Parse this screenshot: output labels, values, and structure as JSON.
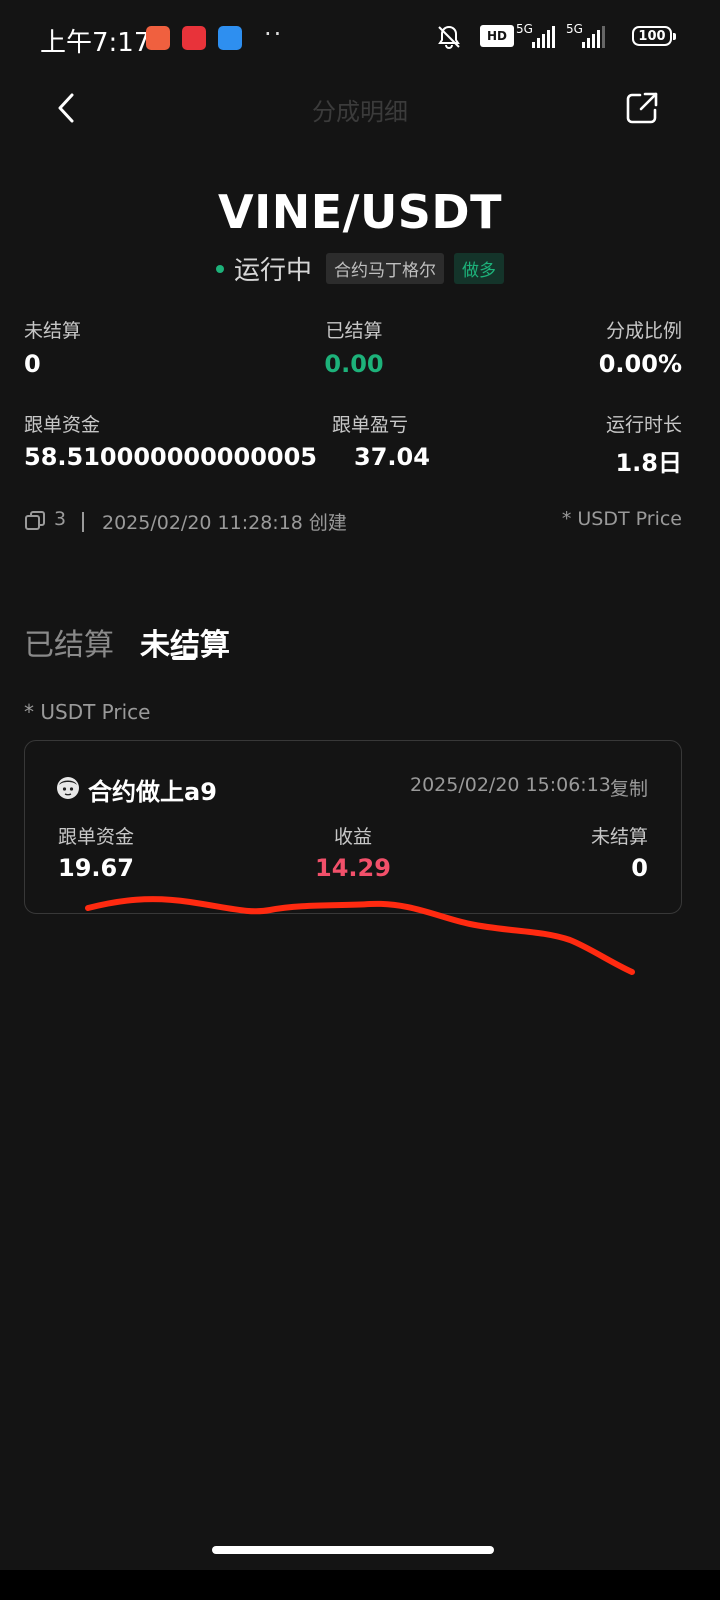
{
  "status_bar": {
    "time": "上午7:17",
    "network_1": "5G",
    "network_2": "5G",
    "hd": "HD",
    "battery": "100",
    "icons": [
      "app-red-icon",
      "app-badge-icon",
      "app-blue-icon",
      "bell-muted-icon"
    ]
  },
  "nav": {
    "title": "分成明细",
    "back_icon": "arrow-left-icon",
    "share_icon": "share-icon"
  },
  "header": {
    "pair": "VINE/USDT",
    "status": "运行中",
    "strategy_tag": "合约马丁格尔",
    "direction_tag": "做多"
  },
  "stats": {
    "unsettled_label": "未结算",
    "unsettled_value": "0",
    "settled_label": "已结算",
    "settled_value": "0.00",
    "share_ratio_label": "分成比例",
    "share_ratio_value": "0.00%",
    "copy_funds_label": "跟单资金",
    "copy_funds_value": "58.510000000000005",
    "copy_pnl_label": "跟单盈亏",
    "copy_pnl_value": "37.04",
    "runtime_label": "运行时长",
    "runtime_value": "1.8日"
  },
  "meta": {
    "copy_count": "3",
    "created": "2025/02/20 11:28:18 创建",
    "price_note": "* USDT Price"
  },
  "tabs": [
    {
      "label": "已结算",
      "active": false
    },
    {
      "label": "未结算",
      "active": true
    }
  ],
  "list_note": "* USDT Price",
  "records": [
    {
      "user": "合约做上a9",
      "timestamp": "2025/02/20 15:06:13",
      "copy_action": "复制",
      "funds_label": "跟单资金",
      "funds_value": "19.67",
      "profit_label": "收益",
      "profit_value": "14.29",
      "unsettled_label": "未结算",
      "unsettled_value": "0"
    }
  ],
  "colors": {
    "background": "#141414",
    "positive": "#1db27a",
    "negative": "#f2506a",
    "annotation": "#ff2a10"
  }
}
